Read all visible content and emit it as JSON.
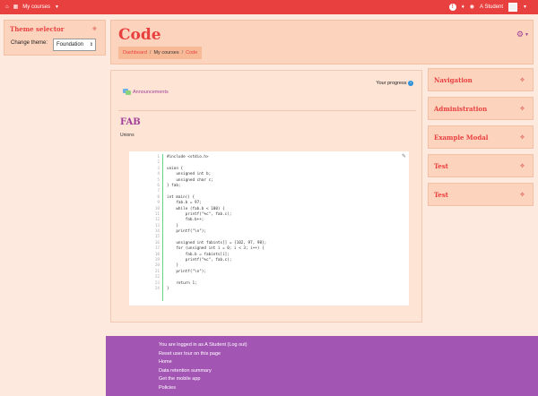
{
  "navbar": {
    "brand_icon": "home-icon",
    "courses_label": "My courses",
    "user_name": "A Student",
    "icons": [
      "info-icon",
      "bell-icon",
      "chat-icon"
    ]
  },
  "theme_selector": {
    "title": "Theme selector",
    "label": "Change theme:",
    "selected": "Foundation"
  },
  "header": {
    "title": "Code",
    "breadcrumb": [
      "Dashboard",
      "My courses",
      "Code"
    ]
  },
  "main": {
    "progress_label": "Your progress",
    "announcements": "Announcements",
    "section_title": "FAB",
    "section_summary": "Unions",
    "code": [
      "#include <stdio.h>",
      "",
      "union {",
      "    unsigned int b;",
      "    unsigned char c;",
      "} fab;",
      "",
      "int main() {",
      "    fab.b = 97;",
      "    while (fab.b < 100) {",
      "        printf(\"%c\", fab.c);",
      "        fab.b++;",
      "    }",
      "    printf(\"\\n\");",
      "",
      "    unsigned int fabints[] = {102, 97, 98};",
      "    for (unsigned int i = 0; i < 3; i++) {",
      "        fab.b = fabints[i];",
      "        printf(\"%c\", fab.c);",
      "    }",
      "    printf(\"\\n\");",
      "",
      "    return 1;",
      "}"
    ]
  },
  "right_blocks": [
    "Navigation",
    "Administration",
    "Example Modal",
    "Test",
    "Test"
  ],
  "footer": {
    "links": [
      "You are logged in as A Student (Log out)",
      "Reset user tour on this page",
      "Home",
      "Data retention summary",
      "Get the mobile app",
      "Policies"
    ]
  },
  "colors": {
    "accent": "#e8403f",
    "purple": "#a13f98",
    "footer": "#a355b4",
    "background": "#fde9de"
  }
}
